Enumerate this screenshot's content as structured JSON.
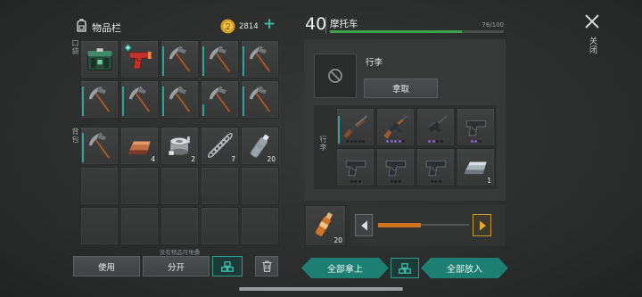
{
  "inventory": {
    "title": "物品栏",
    "coins": "2814",
    "add_coins": "+",
    "pockets_label": "口袋",
    "backpack_label": "背包",
    "pockets": [
      {
        "icon": "green-supply-box-icon"
      },
      {
        "icon": "flare-gun-icon",
        "marker": "marker-icon"
      },
      {
        "icon": "pickaxe-icon",
        "durability": 0.9
      },
      {
        "icon": "pickaxe-icon",
        "durability": 0.9
      },
      {
        "icon": "pickaxe-icon",
        "durability": 0.9
      },
      {
        "icon": "pickaxe-icon",
        "durability": 0.9
      },
      {
        "icon": "pickaxe-icon",
        "durability": 0.9
      },
      {
        "icon": "pickaxe-icon",
        "durability": 0.9
      },
      {
        "icon": "pickaxe-icon",
        "durability": 0.35
      },
      {
        "icon": "pickaxe-icon",
        "durability": 0.9
      }
    ],
    "backpack": [
      {
        "icon": "pickaxe-icon",
        "durability": 0.9
      },
      {
        "icon": "copper-ingot-icon",
        "count": "4"
      },
      {
        "icon": "scrap-parts-icon",
        "count": "2"
      },
      {
        "icon": "spring-icon",
        "count": "7"
      },
      {
        "icon": "water-bottle-icon",
        "count": "20"
      },
      {},
      {},
      {},
      {},
      {},
      {},
      {},
      {},
      {},
      {}
    ],
    "stack_note": "没有物品可堆叠",
    "use_label": "使用",
    "split_label": "分开"
  },
  "vehicle": {
    "level": "40",
    "name": "摩托车",
    "durability_text": "76/100",
    "durability": 0.76,
    "slot_label": "行李",
    "take_label": "拿取",
    "storage_label": "行李",
    "storage": [
      {
        "icon": "shotgun-icon",
        "durability": 0.85,
        "mods": {
          "slots": 5,
          "filled": 0
        }
      },
      {
        "icon": "assault-rifle-icon",
        "mods": {
          "slots": 5,
          "filled": 4
        }
      },
      {
        "icon": "rifle-icon",
        "mods": {
          "slots": 4,
          "filled": 2
        }
      },
      {
        "icon": "pistol-icon",
        "mods": {
          "slots": 3,
          "filled": 2
        }
      },
      {
        "icon": "pistol-icon",
        "mods": {
          "slots": 3,
          "filled": 0
        }
      },
      {
        "icon": "pistol-icon",
        "mods": {
          "slots": 3,
          "filled": 0
        }
      },
      {
        "icon": "pistol-icon",
        "mods": {
          "slots": 3,
          "filled": 0
        }
      },
      {
        "icon": "silver-ingot-icon",
        "count": "1"
      }
    ],
    "transfer": {
      "icon": "bottle-icon",
      "count": "20",
      "amount": 0.47
    },
    "take_all_label": "全部拿上",
    "put_all_label": "全部放入"
  },
  "close_label": "关闭",
  "colors": {
    "accent": "#1d7e72",
    "durability": "#3aa54a",
    "slider": "#d0731f",
    "mod_filled": "#8a5cd6"
  }
}
